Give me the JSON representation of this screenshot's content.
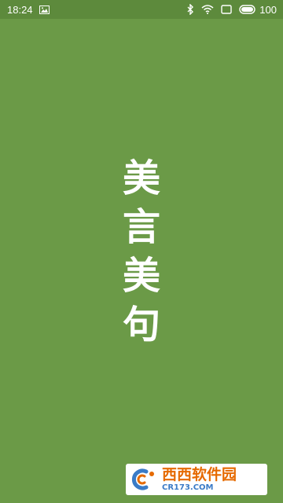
{
  "status_bar": {
    "time": "18:24",
    "battery_level": "100",
    "icons": [
      "image-icon",
      "bluetooth-icon",
      "wifi-icon",
      "screen-icon",
      "battery-icon"
    ]
  },
  "splash": {
    "title_chars": [
      "美",
      "言",
      "美",
      "句"
    ]
  },
  "watermark": {
    "brand": "西西软件园",
    "url": "CR173.COM"
  },
  "colors": {
    "background": "#6b9a47",
    "status_bar": "#5d8a3c",
    "text": "#ffffff",
    "watermark_brand": "#e66a00",
    "watermark_url": "#3a7bc7"
  }
}
